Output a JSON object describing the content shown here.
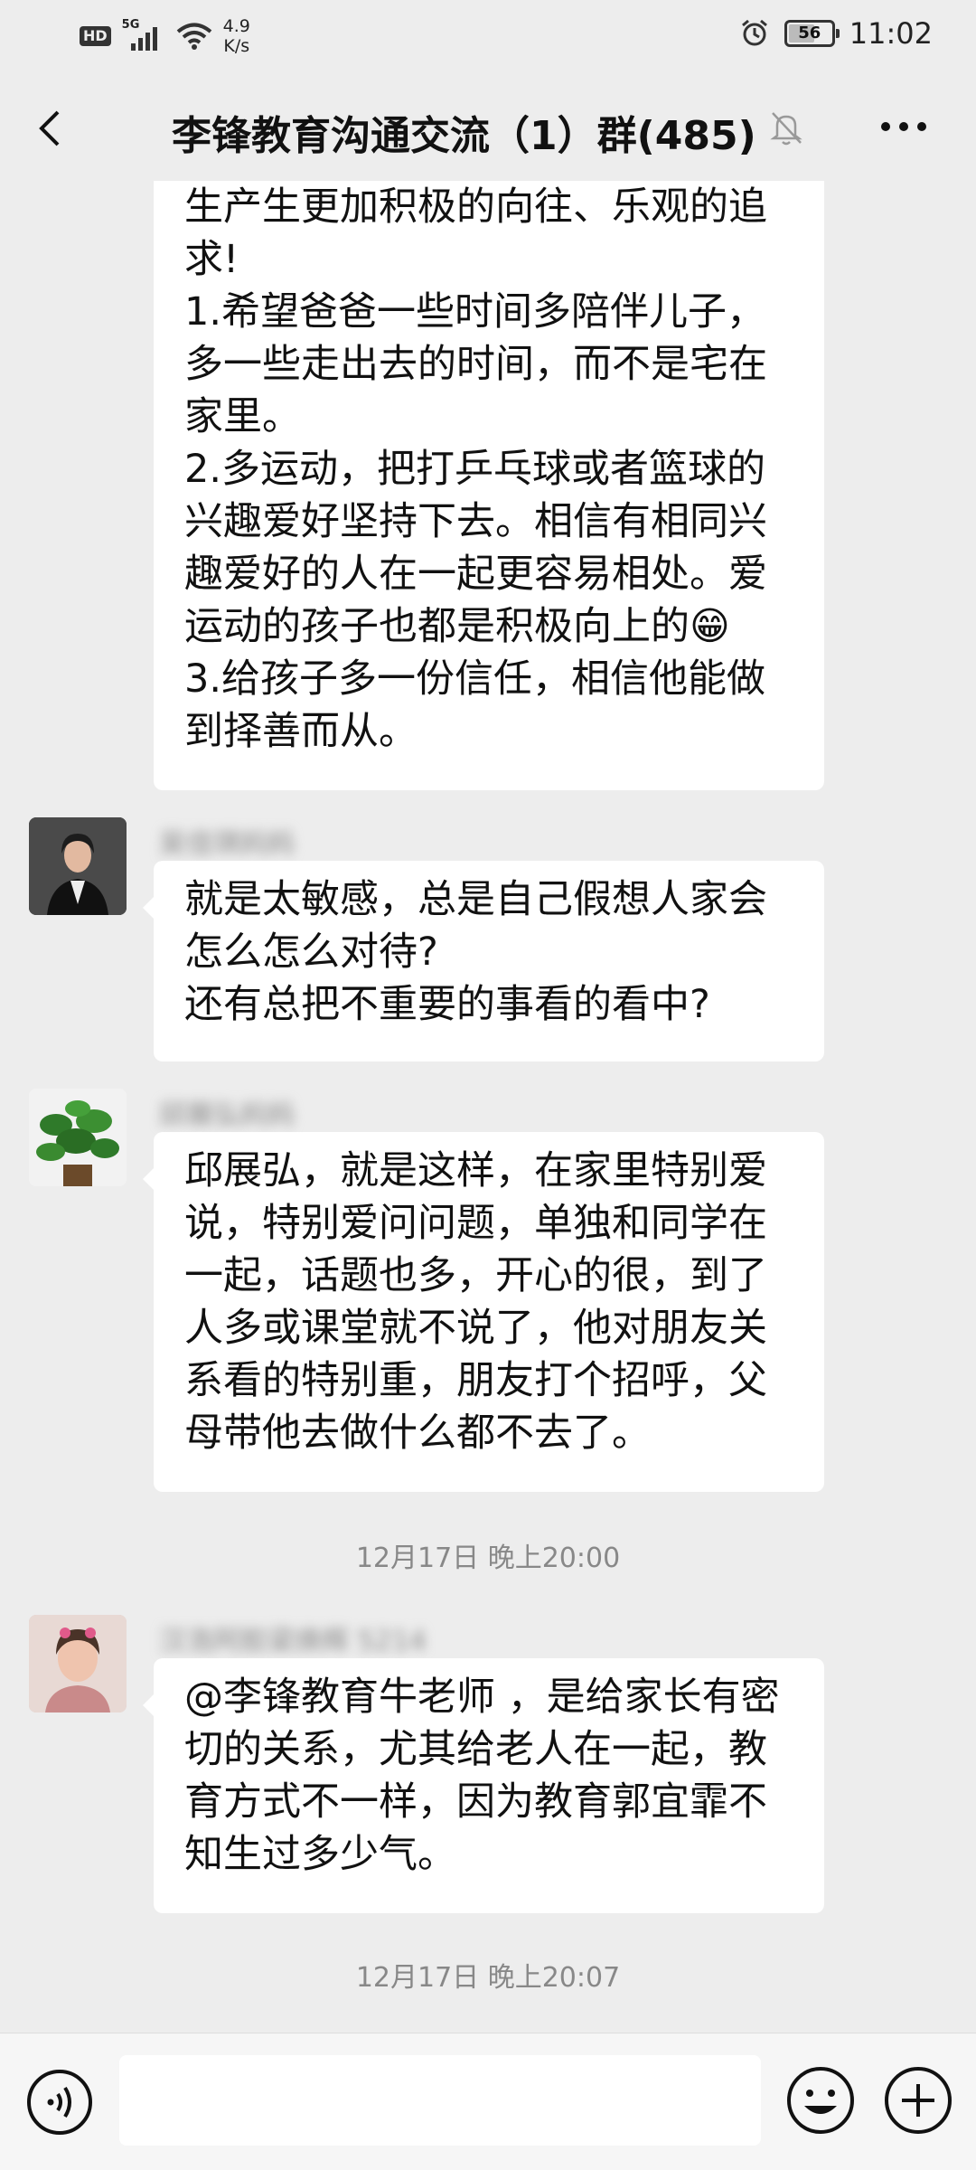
{
  "status_bar": {
    "hd_label": "HD",
    "network_label": "5G",
    "speed_value": "4.9",
    "speed_unit": "K/s",
    "battery_level": "56",
    "time": "11:02"
  },
  "header": {
    "title": "李锋教育沟通交流（1）群(485)",
    "muted": true
  },
  "messages": [
    {
      "continued": true,
      "text": "生产生更加积极的向往、乐观的追求!\n1.希望爸爸一些时间多陪伴儿子，多一些走出去的时间，而不是宅在家里。\n2.多运动，把打乒乓球或者篮球的兴趣爱好坚持下去。相信有相同兴趣爱好的人在一起更容易相处。爱运动的孩子也都是积极向上的😁\n3.给孩子多一份信任，相信他能做到择善而从。"
    },
    {
      "sender": "吴佳琪妈妈",
      "text": "就是太敏感，总是自己假想人家会怎么怎么对待?\n还有总把不重要的事看的看中?"
    },
    {
      "sender": "邱展弘妈妈",
      "text": "邱展弘，就是这样，在家里特别爱说，特别爱问问题，单独和同学在一起，话题也多，开心的很，到了人多或课堂就不说了，他对朋友关系看的特别重，朋友打个招呼，父母带他去做什么都不去了。"
    },
    {
      "timestamp": "12月17日 晚上20:00"
    },
    {
      "sender": "汉浩阿胶梁焕辉 5214",
      "text": "@李锋教育牛老师 ，是给家长有密切的关系，尤其给老人在一起，教育方式不一样，因为教育郭宜霏不知生过多少气。"
    },
    {
      "timestamp": "12月17日 晚上20:07"
    }
  ],
  "input_bar": {
    "placeholder": ""
  },
  "colors": {
    "background": "#ededed",
    "bubble": "#ffffff",
    "meta_text": "#888888"
  }
}
